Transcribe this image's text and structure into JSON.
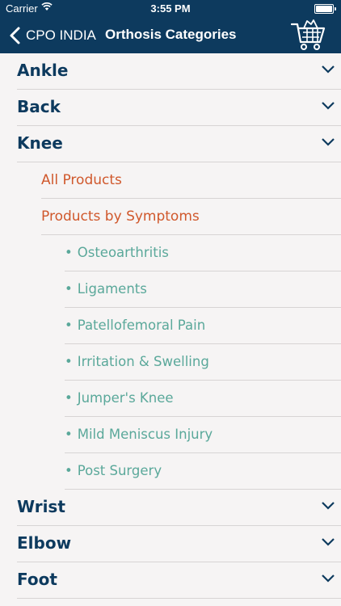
{
  "status_bar": {
    "carrier": "Carrier",
    "time": "3:55 PM"
  },
  "nav": {
    "back_label": "CPO INDIA",
    "title": "Orthosis Categories"
  },
  "categories_top": [
    "Ankle",
    "Back",
    "Knee"
  ],
  "knee_sub": [
    "All Products",
    "Products by Symptoms"
  ],
  "symptoms": [
    "Osteoarthritis",
    "Ligaments",
    "Patellofemoral Pain",
    "Irritation & Swelling",
    "Jumper's Knee",
    "Mild Meniscus Injury",
    "Post Surgery"
  ],
  "categories_bottom": [
    "Wrist",
    "Elbow",
    "Foot"
  ],
  "colors": {
    "primary": "#0d3a5e",
    "accent": "#d0582c",
    "symptom": "#5aa89a",
    "background": "#f6f4f4"
  }
}
